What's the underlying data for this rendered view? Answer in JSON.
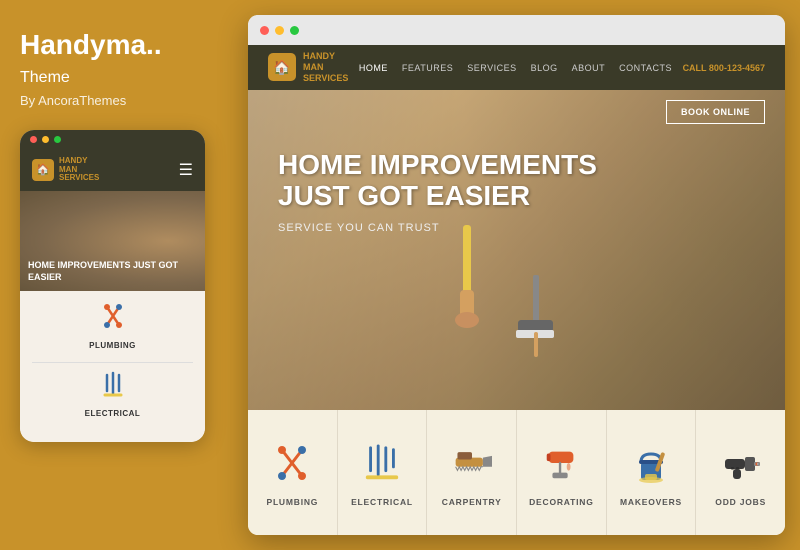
{
  "theme": {
    "title": "Handyma..",
    "subtitle": "Theme",
    "author": "By AncoraThemes",
    "accent_color": "#C8922A"
  },
  "mobile": {
    "logo": {
      "line1": "HANDY",
      "line2": "MAN",
      "line3": "SERVICES"
    },
    "hero_text": "HOME IMPROVEMENTS JUST GOT EASIER",
    "services": [
      {
        "label": "PLUMBING"
      },
      {
        "label": "ELECTRICAL"
      }
    ]
  },
  "browser": {
    "nav": {
      "logo_line1": "HANDY",
      "logo_line2": "MAN",
      "logo_line3": "SERVICES",
      "links": [
        "HOME",
        "FEATURES",
        "SERVICES",
        "BLOG",
        "ABOUT",
        "CONTACTS"
      ],
      "call_label": "CALL",
      "call_number": "800-123-4567"
    },
    "hero": {
      "title_line1": "HOME IMPROVEMENTS",
      "title_line2": "JUST GOT EASIER",
      "subtitle": "SERVICE YOU CAN TRUST",
      "book_button": "BOOK ONLINE"
    },
    "services": [
      {
        "id": "plumbing",
        "label": "PLUMBING"
      },
      {
        "id": "electrical",
        "label": "ELECTRICAL"
      },
      {
        "id": "carpentry",
        "label": "CARPENTRY"
      },
      {
        "id": "decorating",
        "label": "DECORATING"
      },
      {
        "id": "makeovers",
        "label": "MAKEOVERS"
      },
      {
        "id": "odd-jobs",
        "label": "ODD JOBS"
      }
    ]
  }
}
